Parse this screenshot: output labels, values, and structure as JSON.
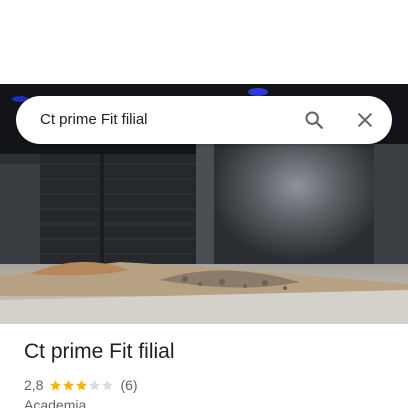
{
  "search": {
    "query": "Ct prime Fit filial",
    "search_icon": "search-icon",
    "close_icon": "close-icon"
  },
  "hero": {
    "image": "building-photo"
  },
  "place": {
    "name": "Ct prime Fit filial",
    "rating": "2,8",
    "stars_filled": 3,
    "stars_total": 5,
    "review_count": "(6)",
    "category": "Academia"
  },
  "colors": {
    "star_filled": "#f6b400",
    "star_empty": "#dadce0",
    "text_primary": "#202124",
    "text_secondary": "#5f6368",
    "icon": "#5f6368"
  }
}
